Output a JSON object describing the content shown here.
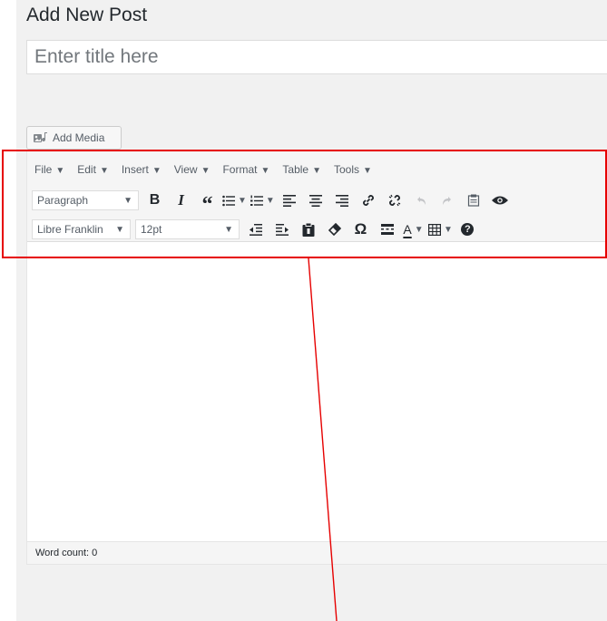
{
  "page": {
    "title": "Add New Post"
  },
  "title_field": {
    "placeholder": "Enter title here",
    "value": ""
  },
  "add_media": {
    "label": "Add Media",
    "icon": "add-media-icon"
  },
  "menubar": [
    {
      "label": "File"
    },
    {
      "label": "Edit"
    },
    {
      "label": "Insert"
    },
    {
      "label": "View"
    },
    {
      "label": "Format"
    },
    {
      "label": "Table"
    },
    {
      "label": "Tools"
    }
  ],
  "toolbar": {
    "format_select": "Paragraph",
    "font_family_select": "Libre Franklin",
    "font_size_select": "12pt",
    "bold_label": "B",
    "italic_label": "I",
    "blockquote_label": "“",
    "special_char_label": "Ω",
    "text_color_label": "A",
    "help_label": "?"
  },
  "status_bar": {
    "word_count": "Word count: 0"
  },
  "annotation": {
    "highlight_color": "#e60000"
  }
}
